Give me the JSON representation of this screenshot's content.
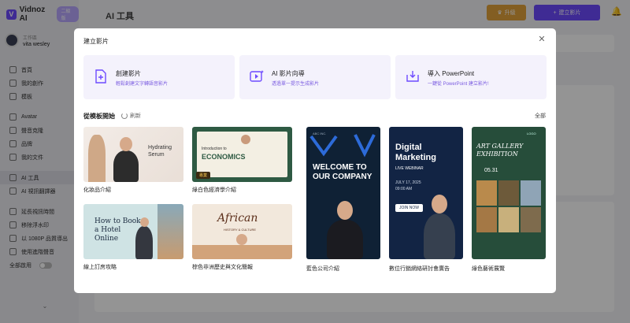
{
  "app": {
    "logo": "Vidnoz AI",
    "plan_badge": "二級版",
    "workspace_label": "工作區",
    "user_name": "vita wesley",
    "page_title": "AI 工具",
    "upgrade_label": "升級",
    "create_label": "建立影片"
  },
  "sidebar": {
    "items": [
      {
        "label": "首頁"
      },
      {
        "label": "我的創作"
      },
      {
        "label": "模板"
      },
      {
        "label": "Avatar"
      },
      {
        "label": "聲音克隆"
      },
      {
        "label": "品牌"
      },
      {
        "label": "我的文件"
      },
      {
        "label": "AI 工具"
      },
      {
        "label": "AI 視訊翻譯器"
      },
      {
        "label": "延長視訊時間"
      },
      {
        "label": "移除浮水印"
      },
      {
        "label": "以 1080P 品質導出"
      },
      {
        "label": "使用進階聲音"
      },
      {
        "label": "全部啟用"
      }
    ]
  },
  "modal": {
    "title": "建立影片",
    "options": [
      {
        "title": "創建影片",
        "desc": "輕鬆創建文字轉語音影片"
      },
      {
        "title": "AI 影片向導",
        "desc": "透過單一提示生成影片"
      },
      {
        "title": "導入 PowerPoint",
        "desc": "一鍵從 PowerPoint 建立影片!"
      }
    ],
    "section_title": "從模板開始",
    "refresh_label": "刷新",
    "all_label": "全部",
    "templates": [
      {
        "label": "化妝品介紹",
        "art_title": "Hydrating Serum"
      },
      {
        "label": "綠白色經濟學介紹",
        "art_title": "ECONOMICS",
        "art_sub": "Introduction to",
        "badge": "專業"
      },
      {
        "label": "線上訂房攻略",
        "art_title": "How to Book a Hotel Online"
      },
      {
        "label": "棕色非洲歷史與文化簡報",
        "art_title": "African",
        "art_sub": "HISTORY & CULTURE"
      },
      {
        "label": "藍色公司介紹",
        "art_title": "WELCOME TO OUR COMPANY",
        "art_brand": "ABC INC."
      },
      {
        "label": "數位行銷網絡研討會廣告",
        "art_title": "Digital Marketing",
        "art_sub": "LIVE WEBINAR",
        "art_date": "JULY 17, 2025",
        "art_time": "09:00 AM",
        "art_cta": "JOIN NOW"
      },
      {
        "label": "綠色藝術展覽",
        "art_title": "ART GALLERY EXHIBITION",
        "art_date": "05.31",
        "art_logo": "LOGO"
      }
    ]
  },
  "colors": {
    "accent": "#6d4aff",
    "upgrade": "#e2a23b"
  }
}
